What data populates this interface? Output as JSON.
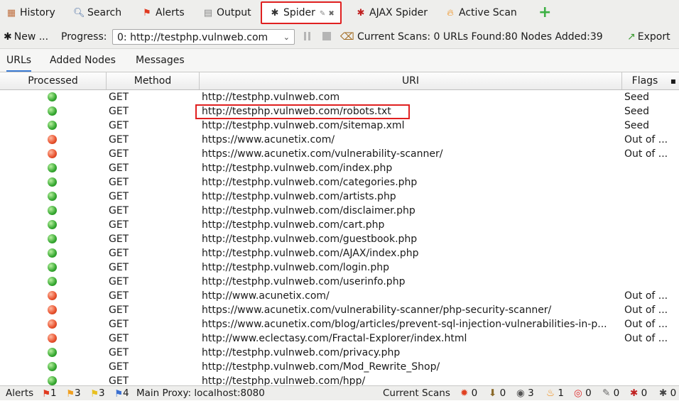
{
  "tabs": [
    {
      "label": "History",
      "icon": "calendar-icon"
    },
    {
      "label": "Search",
      "icon": "magnifier-icon"
    },
    {
      "label": "Alerts",
      "icon": "flag-icon"
    },
    {
      "label": "Output",
      "icon": "document-icon"
    },
    {
      "label": "Spider",
      "icon": "spider-icon"
    },
    {
      "label": "AJAX Spider",
      "icon": "spider-icon"
    },
    {
      "label": "Active Scan",
      "icon": "flame-icon"
    }
  ],
  "toolbar": {
    "new_label": "New ...",
    "progress_label": "Progress:",
    "progress_value": "0: http://testphp.vulnweb.com",
    "current_scans_label": "Current Scans:",
    "current_scans_value": "0",
    "urls_found_label": "URLs Found:",
    "urls_found_value": "80",
    "nodes_added_label": "Nodes Added:",
    "nodes_added_value": "39",
    "export_label": "Export"
  },
  "subtabs": [
    "URLs",
    "Added Nodes",
    "Messages"
  ],
  "columns": [
    "Processed",
    "Method",
    "URI",
    "Flags"
  ],
  "rows": [
    {
      "status": "green",
      "method": "GET",
      "uri": "http://testphp.vulnweb.com",
      "flags": "Seed"
    },
    {
      "status": "green",
      "method": "GET",
      "uri": "http://testphp.vulnweb.com/robots.txt",
      "flags": "Seed"
    },
    {
      "status": "green",
      "method": "GET",
      "uri": "http://testphp.vulnweb.com/sitemap.xml",
      "flags": "Seed"
    },
    {
      "status": "red",
      "method": "GET",
      "uri": "https://www.acunetix.com/",
      "flags": "Out of ..."
    },
    {
      "status": "red",
      "method": "GET",
      "uri": "https://www.acunetix.com/vulnerability-scanner/",
      "flags": "Out of ..."
    },
    {
      "status": "green",
      "method": "GET",
      "uri": "http://testphp.vulnweb.com/index.php",
      "flags": ""
    },
    {
      "status": "green",
      "method": "GET",
      "uri": "http://testphp.vulnweb.com/categories.php",
      "flags": ""
    },
    {
      "status": "green",
      "method": "GET",
      "uri": "http://testphp.vulnweb.com/artists.php",
      "flags": ""
    },
    {
      "status": "green",
      "method": "GET",
      "uri": "http://testphp.vulnweb.com/disclaimer.php",
      "flags": ""
    },
    {
      "status": "green",
      "method": "GET",
      "uri": "http://testphp.vulnweb.com/cart.php",
      "flags": ""
    },
    {
      "status": "green",
      "method": "GET",
      "uri": "http://testphp.vulnweb.com/guestbook.php",
      "flags": ""
    },
    {
      "status": "green",
      "method": "GET",
      "uri": "http://testphp.vulnweb.com/AJAX/index.php",
      "flags": ""
    },
    {
      "status": "green",
      "method": "GET",
      "uri": "http://testphp.vulnweb.com/login.php",
      "flags": ""
    },
    {
      "status": "green",
      "method": "GET",
      "uri": "http://testphp.vulnweb.com/userinfo.php",
      "flags": ""
    },
    {
      "status": "red",
      "method": "GET",
      "uri": "http://www.acunetix.com/",
      "flags": "Out of ..."
    },
    {
      "status": "red",
      "method": "GET",
      "uri": "https://www.acunetix.com/vulnerability-scanner/php-security-scanner/",
      "flags": "Out of ..."
    },
    {
      "status": "red",
      "method": "GET",
      "uri": "https://www.acunetix.com/blog/articles/prevent-sql-injection-vulnerabilities-in-p...",
      "flags": "Out of ..."
    },
    {
      "status": "red",
      "method": "GET",
      "uri": "http://www.eclectasy.com/Fractal-Explorer/index.html",
      "flags": "Out of ..."
    },
    {
      "status": "green",
      "method": "GET",
      "uri": "http://testphp.vulnweb.com/privacy.php",
      "flags": ""
    },
    {
      "status": "green",
      "method": "GET",
      "uri": "http://testphp.vulnweb.com/Mod_Rewrite_Shop/",
      "flags": ""
    },
    {
      "status": "green",
      "method": "GET",
      "uri": "http://testphp.vulnweb.com/hpp/",
      "flags": ""
    }
  ],
  "statusbar": {
    "alerts_label": "Alerts",
    "alerts_high": "1",
    "alerts_medium": "3",
    "alerts_low": "3",
    "alerts_info": "4",
    "proxy_label": "Main Proxy: localhost:8080",
    "current_scans_label": "Current Scans",
    "counters": [
      "0",
      "0",
      "3",
      "1",
      "0",
      "0",
      "0",
      "0"
    ]
  },
  "colors": {
    "green": "#35a830",
    "red": "#e8502c",
    "highlight": "#e02020"
  }
}
